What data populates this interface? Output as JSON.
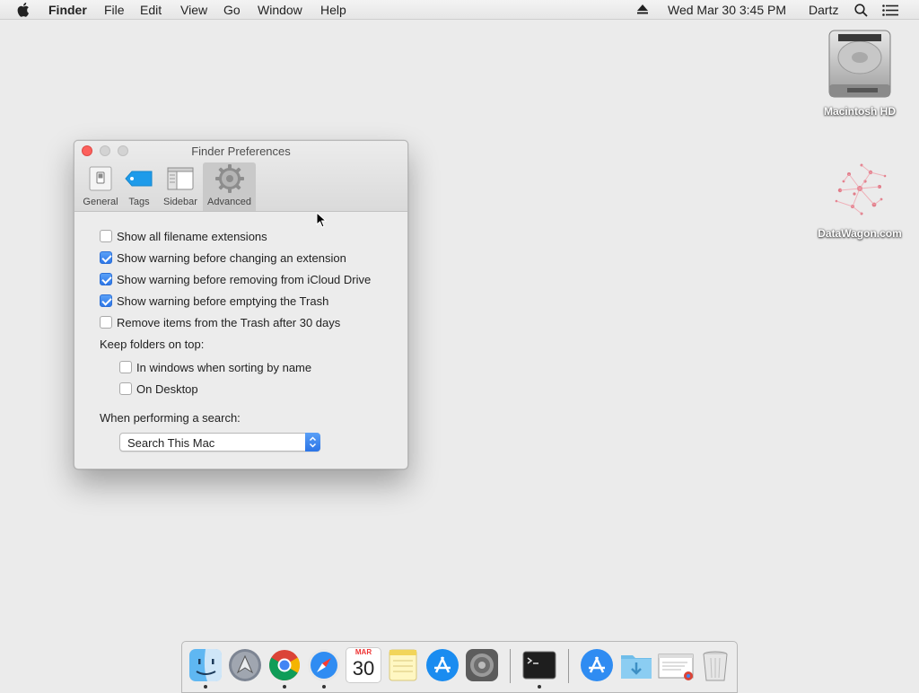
{
  "menubar": {
    "app_name": "Finder",
    "menus": [
      "File",
      "Edit",
      "View",
      "Go",
      "Window",
      "Help"
    ],
    "clock": "Wed Mar 30  3:45 PM",
    "user": "Dartz",
    "icons": [
      "apple-logo",
      "eject-icon",
      "spotlight-icon",
      "notification-center-icon"
    ]
  },
  "desktop": {
    "icons": [
      {
        "label": "Macintosh HD",
        "icon": "hard-drive-icon"
      },
      {
        "label": "DataWagon.com",
        "icon": "datawagon-icon"
      }
    ]
  },
  "window": {
    "title": "Finder Preferences",
    "tabs": [
      {
        "label": "General",
        "icon": "general-switch-icon",
        "selected": false
      },
      {
        "label": "Tags",
        "icon": "tag-icon",
        "selected": false
      },
      {
        "label": "Sidebar",
        "icon": "sidebar-icon",
        "selected": false
      },
      {
        "label": "Advanced",
        "icon": "gear-icon",
        "selected": true
      }
    ],
    "options": [
      {
        "label": "Show all filename extensions",
        "checked": false
      },
      {
        "label": "Show warning before changing an extension",
        "checked": true
      },
      {
        "label": "Show warning before removing from iCloud Drive",
        "checked": true
      },
      {
        "label": "Show warning before emptying the Trash",
        "checked": true
      },
      {
        "label": "Remove items from the Trash after 30 days",
        "checked": false
      }
    ],
    "keep_folders_label": "Keep folders on top:",
    "keep_folders_options": [
      {
        "label": "In windows when sorting by name",
        "checked": false
      },
      {
        "label": "On Desktop",
        "checked": false
      }
    ],
    "search_label": "When performing a search:",
    "search_value": "Search This Mac"
  },
  "dock": {
    "apps": [
      "finder-icon",
      "launchpad-icon",
      "chrome-icon",
      "safari-icon",
      "calendar-icon",
      "notes-icon",
      "app-store-icon",
      "system-preferences-icon",
      "terminal-icon",
      "applications-folder-icon",
      "downloads-folder-icon",
      "document-icon",
      "trash-icon"
    ],
    "calendar_month": "MAR",
    "calendar_day": "30"
  },
  "colors": {
    "accent": "#2d77e8",
    "close": "#fc605c"
  }
}
